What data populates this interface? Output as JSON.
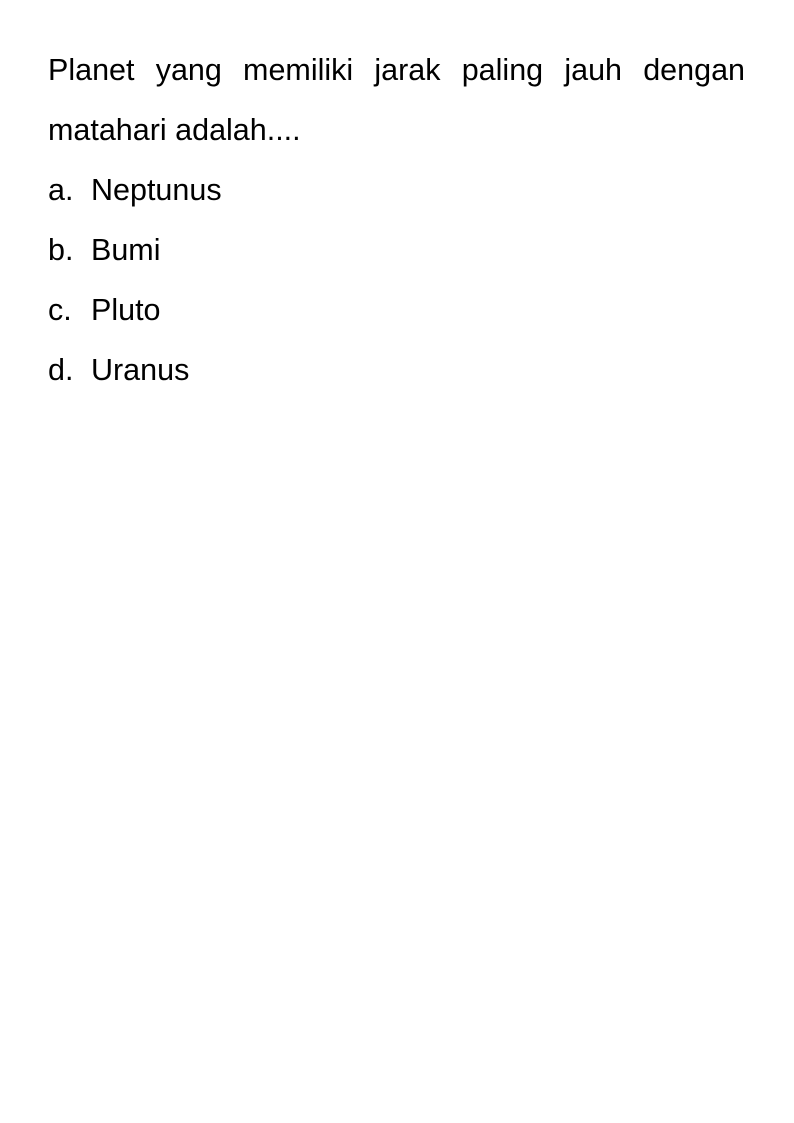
{
  "question": {
    "text": "Planet yang memiliki jarak paling jauh dengan matahari adalah...."
  },
  "options": [
    {
      "letter": "a.",
      "text": "Neptunus"
    },
    {
      "letter": "b.",
      "text": "Bumi"
    },
    {
      "letter": "c.",
      "text": "Pluto"
    },
    {
      "letter": "d.",
      "text": "Uranus"
    }
  ]
}
